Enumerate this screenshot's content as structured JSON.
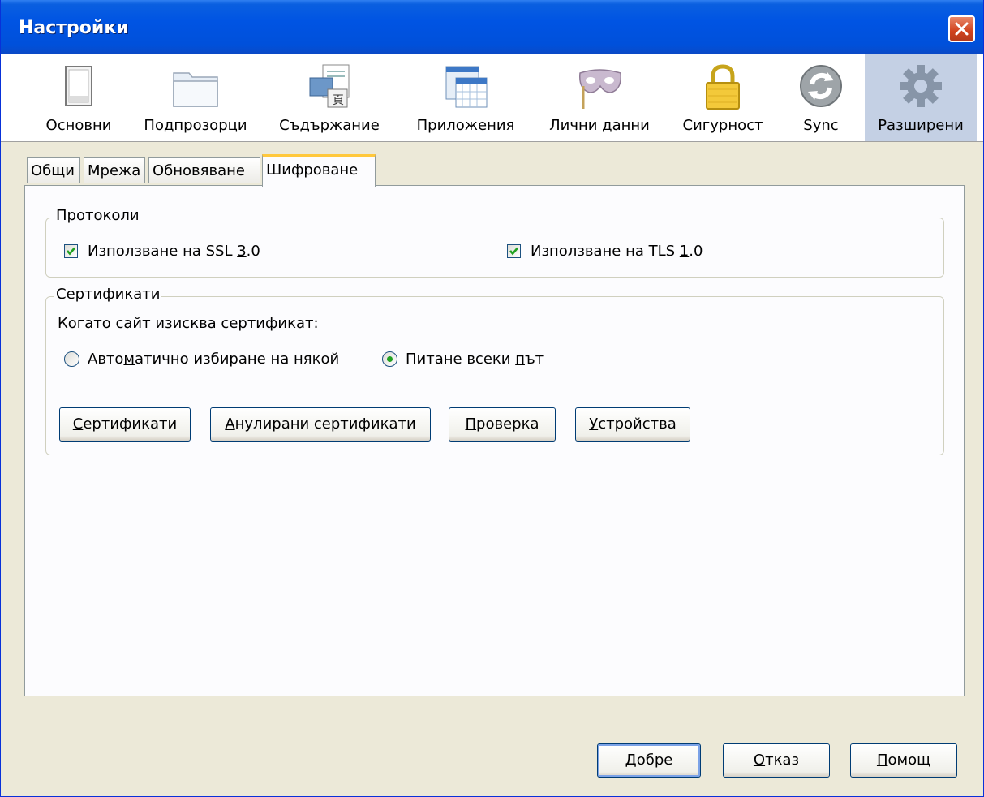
{
  "window": {
    "title": "Настройки"
  },
  "toolbar": {
    "panes": [
      {
        "label": "Основни",
        "icon": "window-icon"
      },
      {
        "label": "Подпрозорци",
        "icon": "folder-tabs-icon"
      },
      {
        "label": "Съдържание",
        "icon": "content-icon"
      },
      {
        "label": "Приложения",
        "icon": "applications-icon"
      },
      {
        "label": "Лични данни",
        "icon": "mask-icon"
      },
      {
        "label": "Сигурност",
        "icon": "padlock-icon"
      },
      {
        "label": "Sync",
        "icon": "sync-icon"
      },
      {
        "label": "Разширени",
        "icon": "gear-icon",
        "selected": true
      }
    ]
  },
  "tabs": [
    {
      "label": "Общи"
    },
    {
      "label": "Мрежа"
    },
    {
      "label": "Обновяване"
    },
    {
      "label": "Шифроване",
      "active": true
    }
  ],
  "protocols": {
    "caption": "Протоколи",
    "ssl": {
      "label_pre": "Използване на SSL ",
      "accesskey": "3",
      "label_post": ".0",
      "checked": true
    },
    "tls": {
      "label_pre": "Използване на TLS ",
      "accesskey": "1",
      "label_post": ".0",
      "checked": true
    }
  },
  "certificates": {
    "caption": "Сертификати",
    "question": "Когато сайт изисква сертификат:",
    "auto": {
      "label_pre": "Авто",
      "accesskey": "м",
      "label_post": "атично избиране на някой",
      "selected": false
    },
    "ask": {
      "label_pre": "Питане всеки ",
      "accesskey": "п",
      "label_post": "ът",
      "selected": true
    },
    "buttons": {
      "view": {
        "accesskey": "С",
        "rest": "ертификати"
      },
      "revoked": {
        "accesskey": "А",
        "rest": "нулирани сертификати"
      },
      "verify": {
        "accesskey": "П",
        "rest": "роверка"
      },
      "devices": {
        "accesskey": "У",
        "rest": "стройства"
      }
    }
  },
  "footer": {
    "ok": {
      "accesskey": "Д",
      "rest": "обре"
    },
    "cancel": {
      "accesskey": "О",
      "rest": "тказ"
    },
    "help": {
      "accesskey": "П",
      "rest": "омощ"
    }
  },
  "colors": {
    "titlebar": "#0054E3",
    "dialog_bg": "#ECE9D8",
    "selected_pane": "#C4D0E4",
    "active_tab_accent": "#FFC83C",
    "check_green": "#21A121"
  }
}
